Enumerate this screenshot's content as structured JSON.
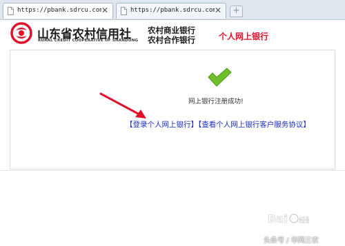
{
  "browser": {
    "tabs": [
      {
        "url": "https://pbank.sdrcu.com/pw",
        "close": "✕"
      },
      {
        "url": "https://pbank.sdrcu.com/pw",
        "close": "✕"
      }
    ],
    "new_tab": "+"
  },
  "header": {
    "brand_cn": "山东省农村信用社",
    "brand_en": "RURAL CREDIT COOPERATIVE OF SHANDONG",
    "sub_line1": "农村商业银行",
    "sub_line2": "农村合作银行",
    "service_title": "个人网上银行"
  },
  "main": {
    "success_text": "网上银行注册成功!",
    "login_link": "【登录个人网上银行】",
    "agreement_link": "【查看个人网上银行客户服务协议】"
  },
  "watermark": {
    "logo_text": "Bai 经验",
    "caption": "头条号 / 华网三农"
  },
  "colors": {
    "brand_red": "#e0112b",
    "link_blue": "#1b2fc4",
    "check_green": "#6fbf2a"
  },
  "icons": {
    "tab": "document-icon",
    "close": "close-icon",
    "logo": "bank-logo-icon",
    "success": "checkmark-icon",
    "pointer": "red-arrow-icon"
  }
}
